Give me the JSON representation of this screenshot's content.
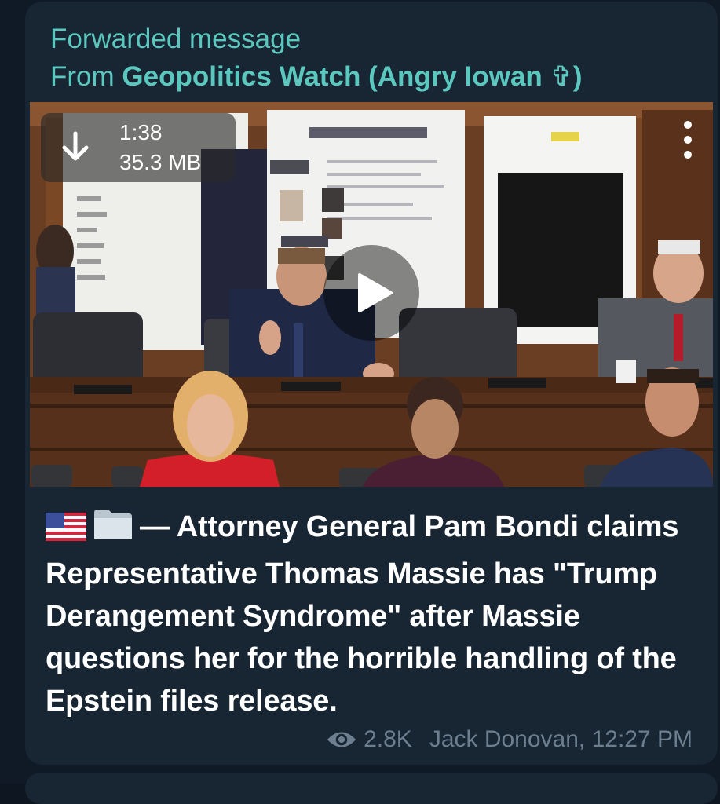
{
  "forward": {
    "label": "Forwarded message",
    "from_prefix": "From ",
    "from_name": "Geopolitics Watch (Angry Iowan ✞)"
  },
  "video": {
    "duration": "1:38",
    "size": "35.3 MB",
    "icons": {
      "download": "download-arrow-icon",
      "menu": "more-vert-icon",
      "play": "play-icon"
    }
  },
  "message": {
    "emojis": [
      "us-flag-emoji",
      "folder-emoji"
    ],
    "text": "— Attorney General Pam Bondi claims Representative Thomas Massie has \"Trump Derangement Syndrome\" after Massie questions her for the horrible handling of the Epstein files release.",
    "views": "2.8K",
    "author_time": "Jack Donovan, 12:27 PM"
  },
  "colors": {
    "bubble": "#182533",
    "accent": "#5bc8c0",
    "meta": "#6d7f8f",
    "text": "#ffffff"
  }
}
